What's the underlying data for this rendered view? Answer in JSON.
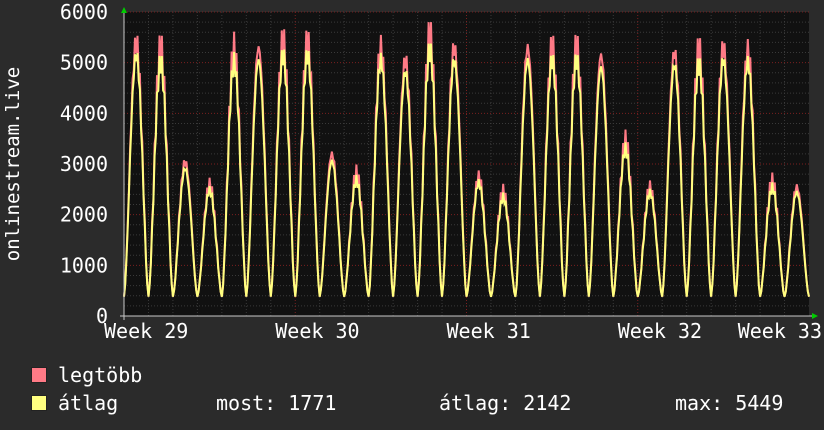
{
  "chart_data": {
    "type": "line",
    "ylabel": "onlinestream.live",
    "ylim": [
      0,
      6000
    ],
    "yticks": [
      0,
      1000,
      2000,
      3000,
      4000,
      5000,
      6000
    ],
    "xticks": [
      "Week 29",
      "Week 30",
      "Week 31",
      "Week 32",
      "Week 33"
    ],
    "x_range_days": [
      0,
      28
    ],
    "grid": true,
    "daily_peaks": [
      5400,
      5250,
      3050,
      2600,
      5250,
      5300,
      5400,
      5400,
      3200,
      2800,
      5300,
      5050,
      5500,
      5300,
      2750,
      2450,
      5300,
      5300,
      5300,
      5150,
      3450,
      2550,
      5200,
      5200,
      5300,
      5250,
      2650,
      2550
    ],
    "daily_min": 380,
    "series": [
      {
        "name": "legtöbb",
        "color": "#ff7a86"
      },
      {
        "name": "átlag",
        "color": "#ffff80"
      }
    ]
  },
  "legend": {
    "max_label": "legtöbb",
    "avg_label": "átlag",
    "most_text": "most: 1771",
    "atlag_text": "átlag: 2142",
    "max_text": "max: 5449"
  },
  "colors": {
    "background": "#2b2b2b",
    "plot_bg": "#111111",
    "grid_minor": "#3a3a3a",
    "grid_major": "#7a2020",
    "axis": "#c8c8c8",
    "arrow": "#00cc00"
  }
}
